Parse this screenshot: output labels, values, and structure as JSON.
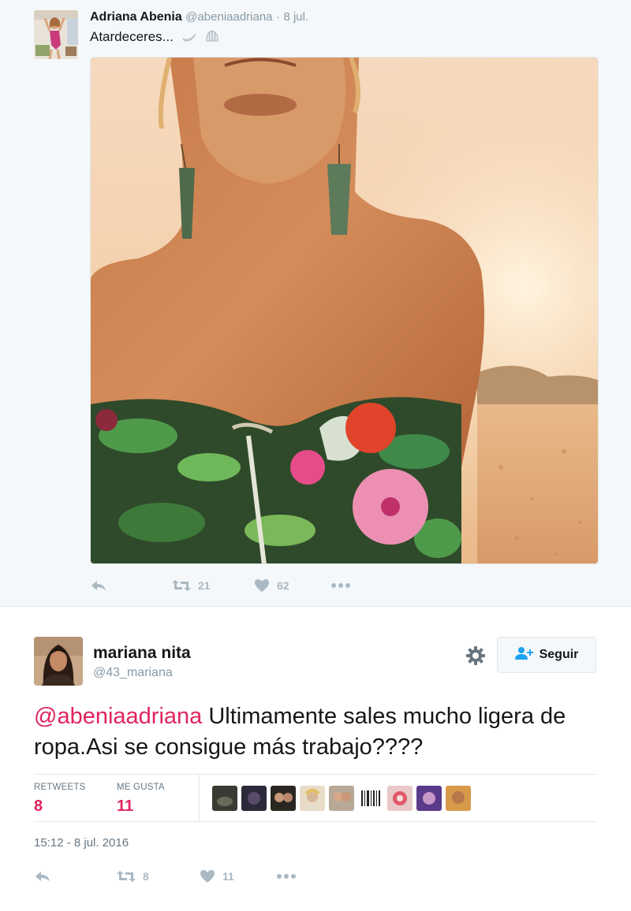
{
  "parent_tweet": {
    "name": "Adriana Abenia",
    "handle": "@abeniaadriana",
    "separator": "·",
    "date": "8 jul.",
    "text": "Atardeceres...",
    "actions": {
      "retweets": "21",
      "likes": "62"
    },
    "icons": [
      "reply-icon",
      "retweet-icon",
      "like-icon",
      "more-icon",
      "moon-emoji-icon",
      "shell-emoji-icon"
    ]
  },
  "tweet": {
    "name": "mariana nita",
    "handle": "@43_mariana",
    "follow_label": "Seguir",
    "mention": "@abeniaadriana",
    "text": " Ultimamente sales mucho ligera de ropa.Asi se consigue más trabajo????",
    "stats": {
      "retweets_label": "RETWEETS",
      "retweets_value": "8",
      "likes_label": "ME GUSTA",
      "likes_value": "11"
    },
    "timestamp": "15:12 - 8 jul. 2016",
    "actions": {
      "retweets": "8",
      "likes": "11"
    }
  },
  "colors": {
    "accent_pink": "#e0245e",
    "muted": "#8899a6",
    "background_parent": "#f5f8fa",
    "divider": "#e1e8ed"
  }
}
